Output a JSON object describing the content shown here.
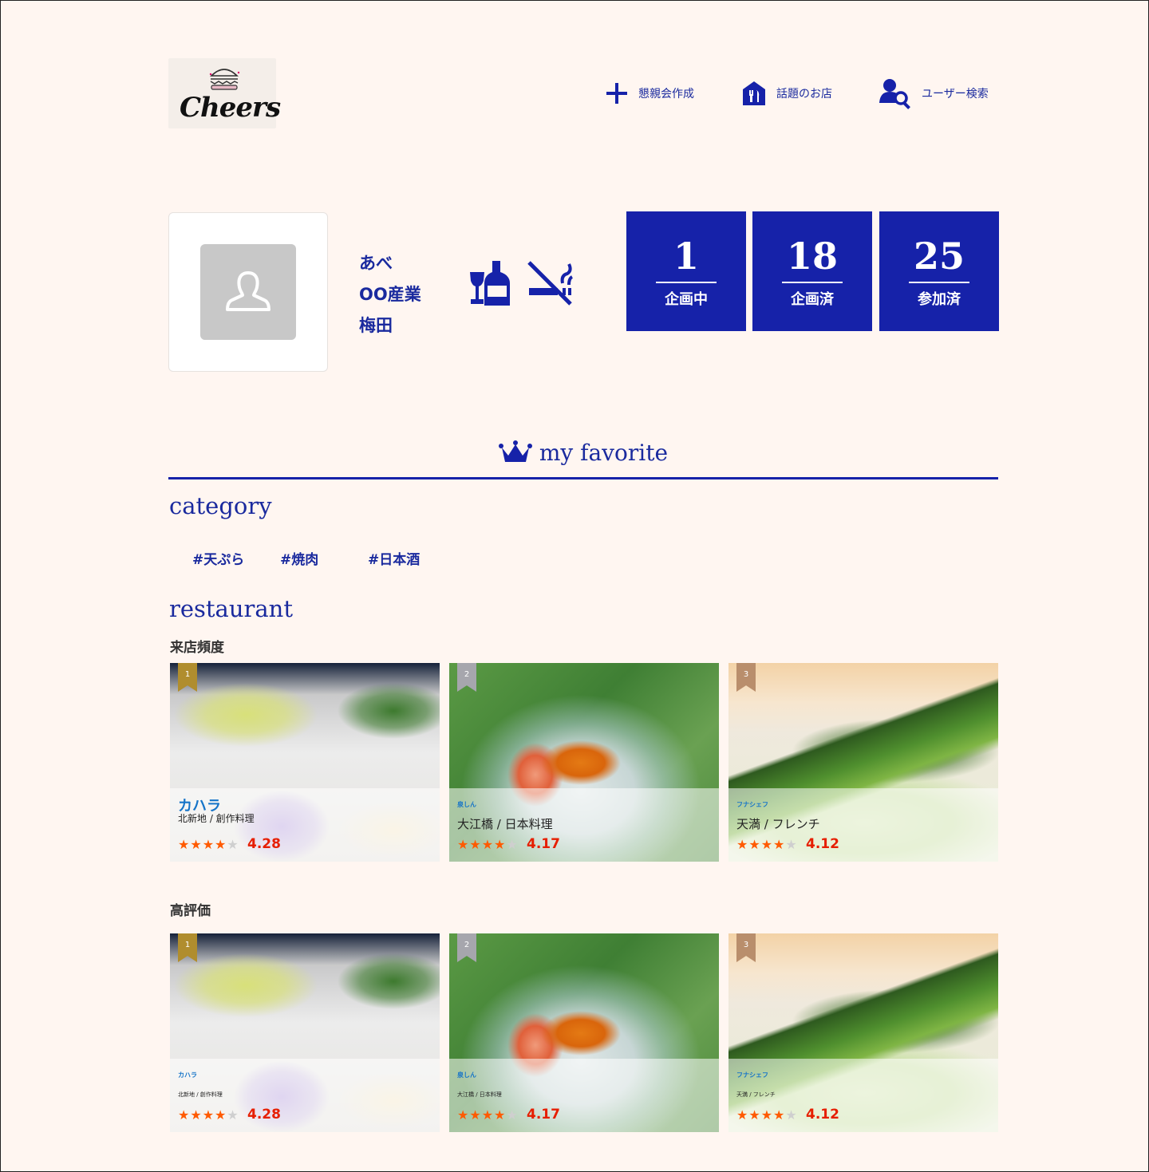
{
  "header": {
    "logo_text": "Cheers",
    "nav": [
      {
        "label": "懇親会作成",
        "icon": "plus-icon"
      },
      {
        "label": "話題のお店",
        "icon": "restaurant-icon"
      },
      {
        "label": "ユーザー検索",
        "icon": "user-search-icon"
      }
    ]
  },
  "profile": {
    "name": "あべ",
    "company": "OO産業",
    "area": "梅田",
    "icons": [
      "drink-icon",
      "no-smoking-icon"
    ]
  },
  "stats": [
    {
      "value": "1",
      "label": "企画中"
    },
    {
      "value": "18",
      "label": "企画済"
    },
    {
      "value": "25",
      "label": "参加済"
    }
  ],
  "favorite": {
    "title": "my favorite",
    "category_heading": "category",
    "tags": [
      "#天ぷら",
      "#焼肉",
      "#日本酒"
    ],
    "restaurant_heading": "restaurant"
  },
  "rankings": [
    {
      "heading": "来店頻度",
      "cards": [
        {
          "rank": "1",
          "name": "カハラ",
          "area": "北新地 / 創作料理",
          "rating": "4.28",
          "stars": 4
        },
        {
          "rank": "2",
          "name": "泉しん",
          "area": "大江橋 / 日本料理",
          "rating": "4.17",
          "stars": 4
        },
        {
          "rank": "3",
          "name": "フナシェフ",
          "area": "天満 / フレンチ",
          "rating": "4.12",
          "stars": 4
        }
      ]
    },
    {
      "heading": "高評価",
      "cards": [
        {
          "rank": "1",
          "name": "カハラ",
          "area": "北新地 / 創作料理",
          "rating": "4.28",
          "stars": 4
        },
        {
          "rank": "2",
          "name": "泉しん",
          "area": "大江橋 / 日本料理",
          "rating": "4.17",
          "stars": 4
        },
        {
          "rank": "3",
          "name": "フナシェフ",
          "area": "天満 / フレンチ",
          "rating": "4.12",
          "stars": 4
        }
      ]
    }
  ],
  "colors": {
    "brand": "#1622a9",
    "background": "#fff6f1",
    "star": "#ff5a00",
    "score": "#e61e00",
    "rank1": "#b08d2e",
    "rank2": "#a6a6ad",
    "rank3": "#b98e6c"
  }
}
